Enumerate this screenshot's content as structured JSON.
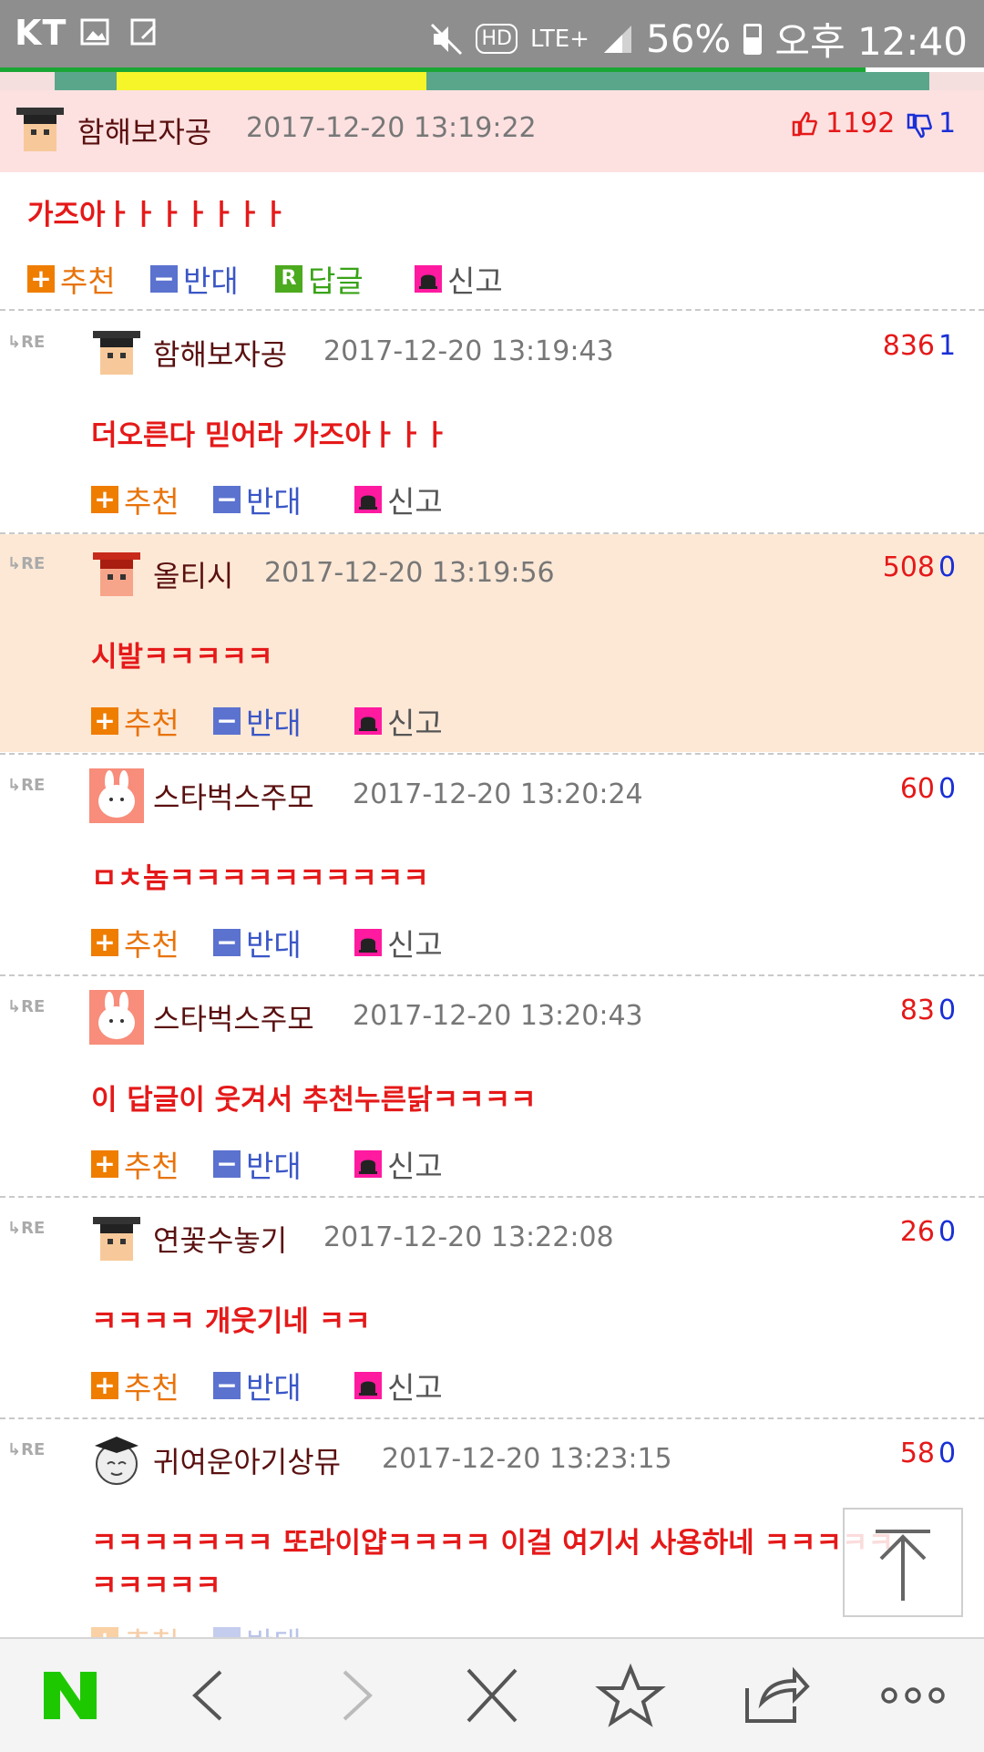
{
  "status": {
    "carrier": "KT",
    "network": "LTE+",
    "battery": "56%",
    "time": "오후 12:40",
    "hd": "HD"
  },
  "comments": [
    {
      "nick": "함해보자공",
      "date": "2017-12-20 13:19:22",
      "up": "1192",
      "down": "1",
      "text": "가즈아ㅏㅏㅏㅏㅏㅏㅏ",
      "best": true
    },
    {
      "nick": "함해보자공",
      "date": "2017-12-20 13:19:43",
      "up": "836",
      "down": "1",
      "text": "더오른다 믿어라 가즈아ㅏㅏㅏ"
    },
    {
      "nick": "올티시",
      "date": "2017-12-20 13:19:56",
      "up": "508",
      "down": "0",
      "text": "시발ㅋㅋㅋㅋㅋ"
    },
    {
      "nick": "스타벅스주모",
      "date": "2017-12-20 13:20:24",
      "up": "60",
      "down": "0",
      "text": "ㅁㅊ놈ㅋㅋㅋㅋㅋㅋㅋㅋㅋㅋ"
    },
    {
      "nick": "스타벅스주모",
      "date": "2017-12-20 13:20:43",
      "up": "83",
      "down": "0",
      "text": "이 답글이 웃겨서 추천누른닭ㅋㅋㅋㅋ"
    },
    {
      "nick": "연꽃수놓기",
      "date": "2017-12-20 13:22:08",
      "up": "26",
      "down": "0",
      "text": "ㅋㅋㅋㅋ 개웃기네 ㅋㅋ"
    },
    {
      "nick": "귀여운아기상뮤",
      "date": "2017-12-20 13:23:15",
      "up": "58",
      "down": "0",
      "text": "ㅋㅋㅋㅋㅋㅋㅋ 또라이얍ㅋㅋㅋㅋ 이걸 여기서 사용하네 ㅋㅋㅋㅋㅋ",
      "text2": "ㅋㅋㅋㅋㅋ"
    }
  ],
  "actions": {
    "recommend": "추천",
    "oppose": "반대",
    "reply": "답글",
    "report": "신고",
    "re": "RE",
    "rep_icon": "R"
  }
}
